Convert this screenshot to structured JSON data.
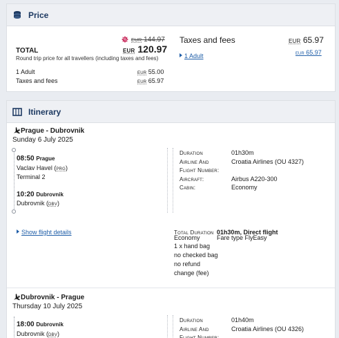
{
  "price": {
    "header_title": "Price",
    "old_currency": "EUR",
    "old_amount": "144.97",
    "total_label": "TOTAL",
    "currency": "EUR",
    "total_amount": "120.97",
    "total_note": "Round trip price for all travellers (including taxes and fees)",
    "lines": [
      {
        "label": "1 Adult",
        "currency": "EUR",
        "amount": "55.00"
      },
      {
        "label": "Taxes and fees",
        "currency": "EUR",
        "amount": "65.97"
      }
    ],
    "taxes_title": "Taxes and fees",
    "taxes_currency": "EUR",
    "taxes_amount": "65.97",
    "taxes_row_label": "1 Adult",
    "taxes_row_currency": "EUR",
    "taxes_row_amount": "65.97"
  },
  "itinerary": {
    "header_title": "Itinerary",
    "show_details_label": "Show flight details",
    "labels": {
      "duration": "Duration",
      "airline_1": "Airline And",
      "airline_2": "Flight Number:",
      "aircraft": "Aircraft:",
      "cabin": "Cabin:",
      "total_duration": "Total Duration"
    },
    "legs": [
      {
        "route": "Prague - Dubrovnik",
        "date": "Sunday 6 July 2025",
        "dep_time": "08:50",
        "dep_city": "Prague",
        "dep_airport": "Vaclav Havel (",
        "dep_code": "PRG",
        "dep_airport_end": ")",
        "dep_terminal": "Terminal 2",
        "arr_time": "10:20",
        "arr_city": "Dubrovnik",
        "arr_airport": "Dubrovnik (",
        "arr_code": "DBV",
        "arr_airport_end": ")",
        "duration": "01h30m",
        "airline": "Croatia Airlines (OU 4327)",
        "aircraft": "Airbus A220-300",
        "cabin": "Economy",
        "total_duration": "01h30m, Direct flight",
        "fare_class": "Economy",
        "fare_type": "Fare type FlyEasy",
        "conditions": [
          "1 x hand bag",
          "no checked bag",
          "no refund",
          "change (fee)"
        ]
      },
      {
        "route": "Dubrovnik - Prague",
        "date": "Thursday 10 July 2025",
        "dep_time": "18:00",
        "dep_city": "Dubrovnik",
        "dep_airport": "Dubrovnik (",
        "dep_code": "DBV",
        "dep_airport_end": ")",
        "duration": "01h40m",
        "airline": "Croatia Airlines (OU 4326)"
      }
    ]
  },
  "colors": {
    "header_text": "#1e3a62",
    "link": "#1f5ea8",
    "discount_badge": "#c8285a"
  }
}
